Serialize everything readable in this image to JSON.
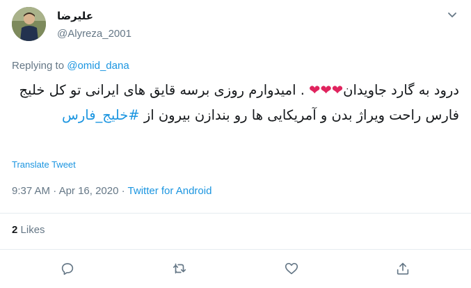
{
  "author": {
    "display_name": "علیرضا",
    "handle": "@Alyreza_2001"
  },
  "reply": {
    "prefix": "Replying to",
    "mention": "@omid_dana"
  },
  "tweet": {
    "text_part1": "درود به گارد جاویدان",
    "hearts": "❤❤❤",
    "text_part2": ". امیدوارم روزی برسه قایق های ایرانی تو کل خلیج فارس راحت ویراژ بدن و آمریکایی ها رو بندازن بیرون از",
    "hashtag": "#خلیج_فارس"
  },
  "translate_label": "Translate Tweet",
  "meta": {
    "time": "9:37 AM",
    "sep1": "·",
    "date": "Apr 16, 2020",
    "sep2": "·",
    "source": "Twitter for Android"
  },
  "likes": {
    "count": "2",
    "label": "Likes"
  },
  "icons": [
    "caret-down-icon",
    "reply-icon",
    "retweet-icon",
    "like-icon",
    "share-icon"
  ],
  "colors": {
    "link": "#1b95e0",
    "muted": "#657786",
    "heart": "#e0245e",
    "divider": "#e6ecf0"
  }
}
